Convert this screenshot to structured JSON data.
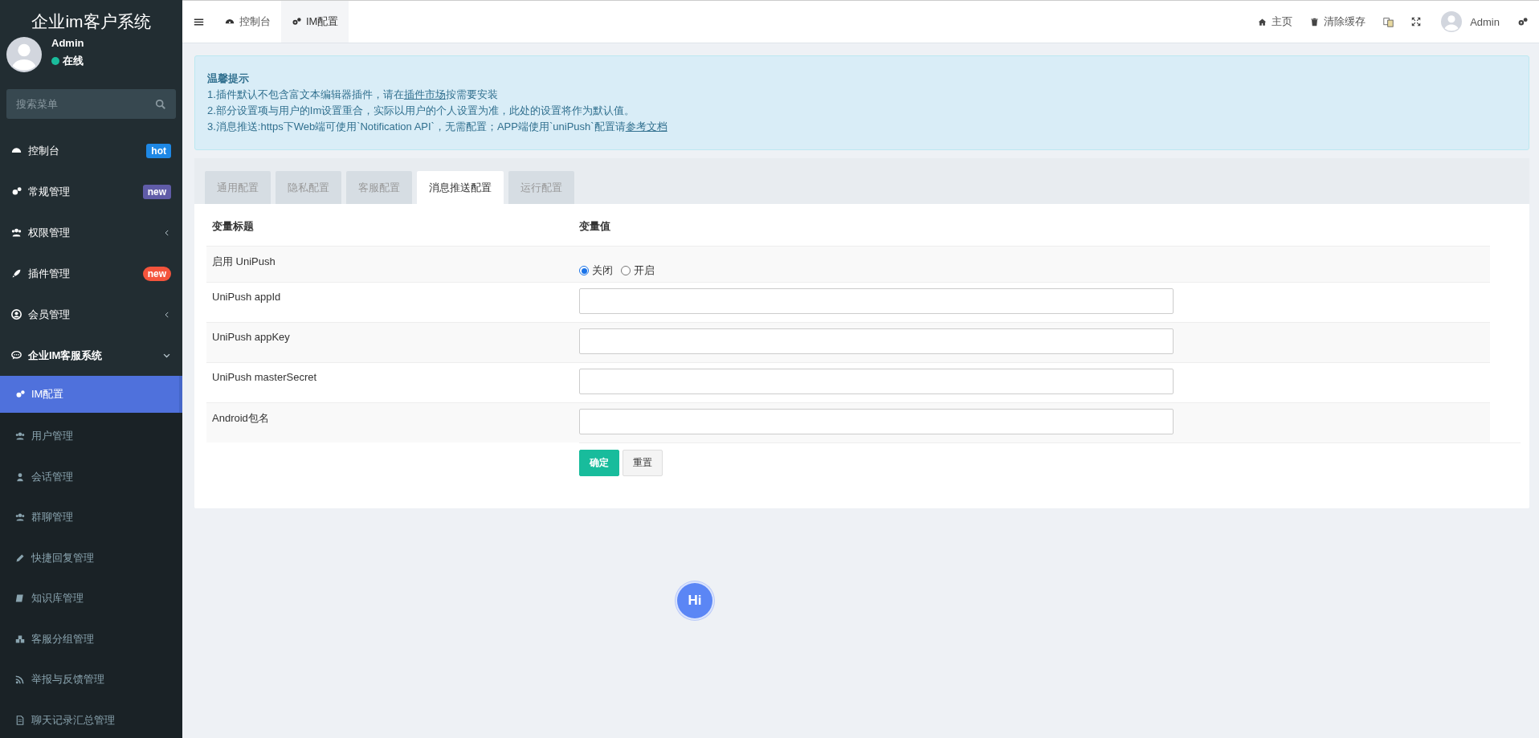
{
  "sidebar": {
    "title": "企业im客户系统",
    "user": {
      "name": "Admin",
      "status": "在线"
    },
    "search": {
      "placeholder": "搜索菜单"
    },
    "menu": [
      {
        "label": "控制台",
        "selected": false,
        "badge": {
          "text": "hot",
          "kind": "tag",
          "color": "#1e88e5"
        }
      },
      {
        "label": "常规管理",
        "selected": false,
        "badge": {
          "text": "new",
          "kind": "tag",
          "color": "#605ca8"
        }
      },
      {
        "label": "权限管理",
        "selected": false,
        "expanded": false
      },
      {
        "label": "插件管理",
        "selected": false,
        "badge": {
          "text": "new",
          "kind": "pill",
          "color": "#f4543c"
        }
      },
      {
        "label": "会员管理",
        "selected": false,
        "expanded": false
      },
      {
        "label": "企业IM客服系统",
        "selected": false,
        "expanded": true,
        "children": [
          {
            "label": "IM配置",
            "selected": true
          },
          {
            "label": "用户管理",
            "selected": false
          },
          {
            "label": "会话管理",
            "selected": false
          },
          {
            "label": "群聊管理",
            "selected": false
          },
          {
            "label": "快捷回复管理",
            "selected": false
          },
          {
            "label": "知识库管理",
            "selected": false
          },
          {
            "label": "客服分组管理",
            "selected": false
          },
          {
            "label": "举报与反馈管理",
            "selected": false
          },
          {
            "label": "聊天记录汇总管理",
            "selected": false
          }
        ]
      }
    ]
  },
  "topbar": {
    "tabs": [
      {
        "label": "控制台",
        "selected": false
      },
      {
        "label": "IM配置",
        "selected": true
      }
    ],
    "links": [
      {
        "label": "主页"
      },
      {
        "label": "清除缓存"
      }
    ],
    "user": {
      "name": "Admin"
    }
  },
  "notice": {
    "title": "温馨提示",
    "lines": [
      {
        "text": "1.插件默认不包含富文本编辑器插件，请在",
        "link": "插件市场",
        "after": "按需要安装"
      },
      {
        "text": "2.部分设置项与用户的Im设置重合，实际以用户的个人设置为准，此处的设置将作为默认值。"
      },
      {
        "text": "3.消息推送:https下Web端可使用`Notification API`，无需配置；APP端使用`uniPush`配置请",
        "link": "参考文档"
      }
    ]
  },
  "config": {
    "tabs": [
      {
        "label": "通用配置",
        "selected": false
      },
      {
        "label": "隐私配置",
        "selected": false
      },
      {
        "label": "客服配置",
        "selected": false
      },
      {
        "label": "消息推送配置",
        "selected": true
      },
      {
        "label": "运行配置",
        "selected": false
      }
    ],
    "columns": [
      "变量标题",
      "变量值"
    ],
    "rows": [
      {
        "label": "启用 UniPush",
        "kind": "radio",
        "options": [
          {
            "label": "关闭",
            "selected": true
          },
          {
            "label": "开启",
            "selected": false
          }
        ]
      },
      {
        "label": "UniPush appId",
        "kind": "text"
      },
      {
        "label": "UniPush appKey",
        "kind": "text"
      },
      {
        "label": "UniPush masterSecret",
        "kind": "text"
      },
      {
        "label": "Android包名",
        "kind": "text"
      }
    ],
    "buttons": [
      {
        "label": "确定",
        "kind": "primary"
      },
      {
        "label": "重置",
        "kind": "default"
      }
    ]
  },
  "chat_button": {
    "label": "Hi"
  }
}
